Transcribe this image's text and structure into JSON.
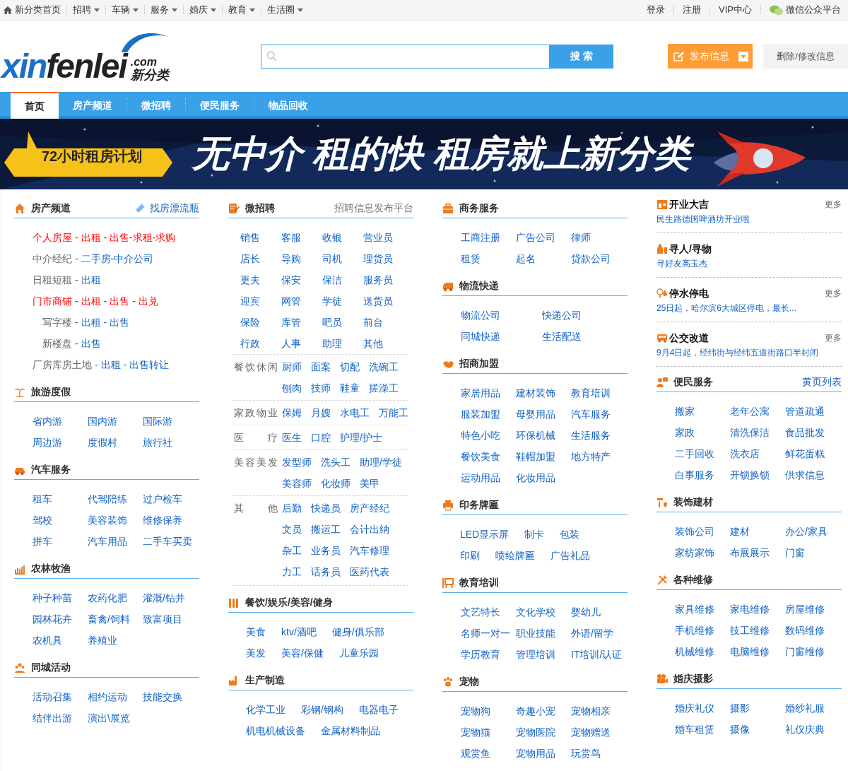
{
  "top_bar": {
    "left": [
      {
        "label": "新分类首页",
        "kind": "home",
        "dropdown": false
      },
      {
        "label": "招聘",
        "kind": "menu",
        "dropdown": true
      },
      {
        "label": "车辆",
        "kind": "menu",
        "dropdown": true
      },
      {
        "label": "服务",
        "kind": "menu",
        "dropdown": true
      },
      {
        "label": "婚庆",
        "kind": "menu",
        "dropdown": true
      },
      {
        "label": "教育",
        "kind": "menu",
        "dropdown": true
      },
      {
        "label": "生活圈",
        "kind": "menu",
        "dropdown": true
      }
    ],
    "right": [
      {
        "label": "登录",
        "kind": "link"
      },
      {
        "label": "注册",
        "kind": "link"
      },
      {
        "label": "VIP中心",
        "kind": "link"
      },
      {
        "label": "微信公众平台",
        "kind": "wechat"
      }
    ]
  },
  "header": {
    "logo": {
      "latin_1": "xin",
      "latin_2": "fenlei",
      "domain": ".com",
      "chinese": "新分类"
    },
    "search": {
      "button": "搜 索"
    },
    "post_button": "发布信息",
    "edit_button": "删除/修改信息"
  },
  "nav": [
    {
      "label": "首页",
      "selected": true
    },
    {
      "label": "房产频道",
      "selected": false
    },
    {
      "label": "微招聘",
      "selected": false
    },
    {
      "label": "便民服务",
      "selected": false
    },
    {
      "label": "物品回收",
      "selected": false
    }
  ],
  "banner": {
    "badge": "72小时租房计划",
    "slogan": "无中介 租的快 租房就上新分类"
  },
  "columns": [
    {
      "sections": [
        {
          "kind": "house",
          "title": "房产频道",
          "side_link": "找房漂流瓶",
          "rows": [
            {
              "label": "个人房屋",
              "hot": true,
              "indented": false,
              "links": [
                "- 出租",
                "- 出售-求租-求购"
              ]
            },
            {
              "label": "中介经纪",
              "hot": false,
              "indented": false,
              "links": [
                "- 二手房-中介公司"
              ]
            },
            {
              "label": "日租短租",
              "hot": false,
              "indented": false,
              "links": [
                "- 出租"
              ]
            },
            {
              "label": "门市商铺",
              "hot": true,
              "indented": false,
              "links": [
                "- 出租",
                "- 出售",
                "- 出兑"
              ]
            },
            {
              "label": "写字楼",
              "hot": false,
              "indented": true,
              "links": [
                "- 出租",
                "- 出售"
              ]
            },
            {
              "label": "新楼盘",
              "hot": false,
              "indented": true,
              "links": [
                "- 出售"
              ]
            },
            {
              "label": "厂房库房土地",
              "hot": false,
              "indented": false,
              "links": [
                "- 出租",
                "- 出售转让"
              ]
            }
          ]
        },
        {
          "kind": "grid",
          "title": "旅游度假",
          "rows": [
            [
              "省内游",
              "国内游",
              "国际游"
            ],
            [
              "周边游",
              "度假村",
              "旅行社"
            ]
          ]
        },
        {
          "kind": "grid",
          "title": "汽车服务",
          "rows": [
            [
              "租车",
              "代驾陪练",
              "过户检车"
            ],
            [
              "驾校",
              "美容装饰",
              "维修保养"
            ],
            [
              "拼车",
              "汽车用品",
              "二手车买卖"
            ]
          ]
        },
        {
          "kind": "grid",
          "title": "农林牧渔",
          "rows": [
            [
              "种子种苗",
              "农药化肥",
              "灌溉/钻井"
            ],
            [
              "园林花卉",
              "畜禽/饲料",
              "致富项目"
            ],
            [
              "农机具",
              "养殖业"
            ]
          ]
        },
        {
          "kind": "grid",
          "title": "同城活动",
          "rows": [
            [
              "活动召集",
              "相约运动",
              "技能交换"
            ],
            [
              "结伴出游",
              "演出\\展览"
            ]
          ]
        }
      ]
    },
    {
      "sections": [
        {
          "kind": "jobs",
          "title": "微招聘",
          "side_text": "招聘信息发布平台",
          "rows": [
            [
              "销售",
              "客服",
              "收银",
              "营业员"
            ],
            [
              "店长",
              "导购",
              "司机",
              "理货员"
            ],
            [
              "更夫",
              "保安",
              "保洁",
              "服务员"
            ],
            [
              "迎宾",
              "网管",
              "学徒",
              "送货员"
            ],
            [
              "保险",
              "库管",
              "吧员",
              "前台"
            ],
            [
              "行政",
              "人事",
              "助理",
              "其他"
            ]
          ],
          "groups": [
            {
              "label": "餐饮休闲",
              "rows": [
                [
                  "厨师",
                  "面案",
                  "切配",
                  "洗碗工"
                ],
                [
                  "刨肉",
                  "技师",
                  "鞋童",
                  "搓澡工"
                ]
              ]
            },
            {
              "label": "家政物业",
              "rows": [
                [
                  "保姆",
                  "月嫂",
                  "水电工",
                  "万能工"
                ]
              ]
            },
            {
              "label": "医疗",
              "rows": [
                [
                  "医生",
                  "口腔",
                  "护理/护士"
                ]
              ]
            },
            {
              "label": "美容美发",
              "rows": [
                [
                  "发型师",
                  "洗头工",
                  "助理/学徒"
                ],
                [
                  "美容师",
                  "化妆师",
                  "美甲"
                ]
              ]
            },
            {
              "label": "其他",
              "rows": [
                [
                  "后勤",
                  "快递员",
                  "房产经纪"
                ],
                [
                  "文员",
                  "搬运工",
                  "会计出纳"
                ],
                [
                  "杂工",
                  "业务员",
                  "汽车修理"
                ],
                [
                  "力工",
                  "话务员",
                  "医药代表"
                ]
              ]
            }
          ]
        },
        {
          "kind": "flow",
          "title": "餐饮/娱乐/美容/健身",
          "rows": [
            [
              "美食",
              "ktv/酒吧",
              "健身/俱乐部"
            ],
            [
              "美发",
              "美容/保健",
              "儿童乐园"
            ]
          ]
        },
        {
          "kind": "flow",
          "title": "生产制造",
          "rows": [
            [
              "化学工业",
              "彩钢/钢构",
              "电器电子"
            ],
            [
              "机电机械设备",
              "金属材料制品"
            ]
          ]
        }
      ]
    },
    {
      "sections": [
        {
          "kind": "grid",
          "title": "商务服务",
          "rows": [
            [
              "工商注册",
              "广告公司",
              "律师"
            ],
            [
              "租赁",
              "起名",
              "贷款公司"
            ]
          ]
        },
        {
          "kind": "grid",
          "title": "物流快递",
          "rows": [
            [
              "物流公司",
              "快递公司"
            ],
            [
              "同城快递",
              "生活配送"
            ]
          ]
        },
        {
          "kind": "grid",
          "title": "招商加盟",
          "rows": [
            [
              "家居用品",
              "建材装饰",
              "教育培训"
            ],
            [
              "服装加盟",
              "母婴用品",
              "汽车服务"
            ],
            [
              "特色小吃",
              "环保机械",
              "生活服务"
            ],
            [
              "餐饮美食",
              "鞋帽加盟",
              "地方特产"
            ],
            [
              "运动用品",
              "化妆用品"
            ]
          ]
        },
        {
          "kind": "flow",
          "title": "印务牌匾",
          "rows": [
            [
              "LED显示屏",
              "制卡",
              "包装"
            ],
            [
              "印刷",
              "喷绘牌匾",
              "广告礼品"
            ]
          ]
        },
        {
          "kind": "grid",
          "title": "教育培训",
          "rows": [
            [
              "文艺特长",
              "文化学校",
              "婴幼儿"
            ],
            [
              "名师一对一",
              "职业技能",
              "外语/留学"
            ],
            [
              "学历教育",
              "管理培训",
              "IT培训/认证"
            ]
          ]
        },
        {
          "kind": "grid",
          "title": "宠物",
          "rows": [
            [
              "宠物狗",
              "奇趣小宠",
              "宠物相亲"
            ],
            [
              "宠物猫",
              "宠物医院",
              "宠物赠送"
            ],
            [
              "观赏鱼",
              "宠物用品",
              "玩赏鸟"
            ]
          ]
        }
      ]
    },
    {
      "sections": [
        {
          "kind": "notices",
          "items": [
            {
              "title": "开业大吉",
              "more": "更多",
              "text": "民生路德国啤酒坊开业啦"
            },
            {
              "title": "寻人/寻物",
              "text": "寻好友高玉杰"
            },
            {
              "title": "停水停电",
              "more": "更多",
              "text": "25日起，哈尔滨6大城区停电，最长..."
            },
            {
              "title": "公交改道",
              "more": "更多",
              "text": "9月4日起，经纬街与经纬五道街路口半封闭"
            }
          ]
        },
        {
          "kind": "grid",
          "title": "便民服务",
          "side_link": "黄页列表",
          "rows": [
            [
              "搬家",
              "老年公寓",
              "管道疏通"
            ],
            [
              "家政",
              "清洗保洁",
              "食品批发"
            ],
            [
              "二手回收",
              "洗衣店",
              "鲜花蛋糕"
            ],
            [
              "白事服务",
              "开锁换锁",
              "供求信息"
            ]
          ]
        },
        {
          "kind": "grid",
          "title": "装饰建材",
          "rows": [
            [
              "装饰公司",
              "建材",
              "办公/家具"
            ],
            [
              "家纺家饰",
              "布展展示",
              "门窗"
            ]
          ]
        },
        {
          "kind": "grid",
          "title": "各种维修",
          "rows": [
            [
              "家具维修",
              "家电维修",
              "房屋维修"
            ],
            [
              "手机维修",
              "技工维修",
              "数码维修"
            ],
            [
              "机械维修",
              "电脑维修",
              "门窗维修"
            ]
          ]
        },
        {
          "kind": "grid",
          "title": "婚庆摄影",
          "rows": [
            [
              "婚庆礼仪",
              "摄影",
              "婚纱礼服"
            ],
            [
              "婚车租赁",
              "摄像",
              "礼仪庆典"
            ]
          ]
        }
      ]
    }
  ]
}
